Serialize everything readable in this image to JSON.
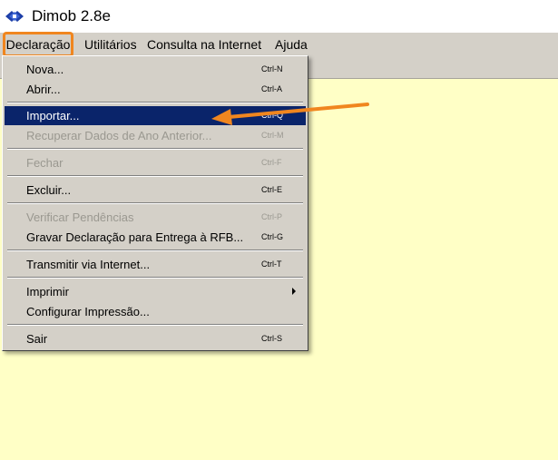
{
  "window": {
    "title": "Dimob 2.8e",
    "icon": "dimob-logo-icon"
  },
  "menubar": {
    "items": [
      {
        "label": "Declaração",
        "active": true
      },
      {
        "label": "Utilitários"
      },
      {
        "label": "Consulta na Internet"
      },
      {
        "label": "Ajuda"
      }
    ]
  },
  "menu": {
    "items": [
      {
        "label": "Nova...",
        "shortcut": "Ctrl-N",
        "enabled": true
      },
      {
        "label": "Abrir...",
        "shortcut": "Ctrl-A",
        "enabled": true
      },
      {
        "label": "Importar...",
        "shortcut": "Ctrl-Q",
        "enabled": true,
        "highlighted": true
      },
      {
        "label": "Recuperar Dados de Ano Anterior...",
        "shortcut": "Ctrl-M",
        "enabled": false
      },
      {
        "label": "Fechar",
        "shortcut": "Ctrl-F",
        "enabled": false
      },
      {
        "label": "Excluir...",
        "shortcut": "Ctrl-E",
        "enabled": true
      },
      {
        "label": "Verificar Pendências",
        "shortcut": "Ctrl-P",
        "enabled": false
      },
      {
        "label": "Gravar Declaração para Entrega à RFB...",
        "shortcut": "Ctrl-G",
        "enabled": true
      },
      {
        "label": "Transmitir via Internet...",
        "shortcut": "Ctrl-T",
        "enabled": true
      },
      {
        "label": "Imprimir",
        "shortcut": "",
        "enabled": true,
        "submenu": true
      },
      {
        "label": "Configurar Impressão...",
        "shortcut": "",
        "enabled": true
      },
      {
        "label": "Sair",
        "shortcut": "Ctrl-S",
        "enabled": true
      }
    ]
  },
  "colors": {
    "menu_bg": "#d4d0c8",
    "highlight_bg": "#0a246a",
    "workspace_bg": "#ffffc6",
    "annotation": "#f0861f"
  }
}
